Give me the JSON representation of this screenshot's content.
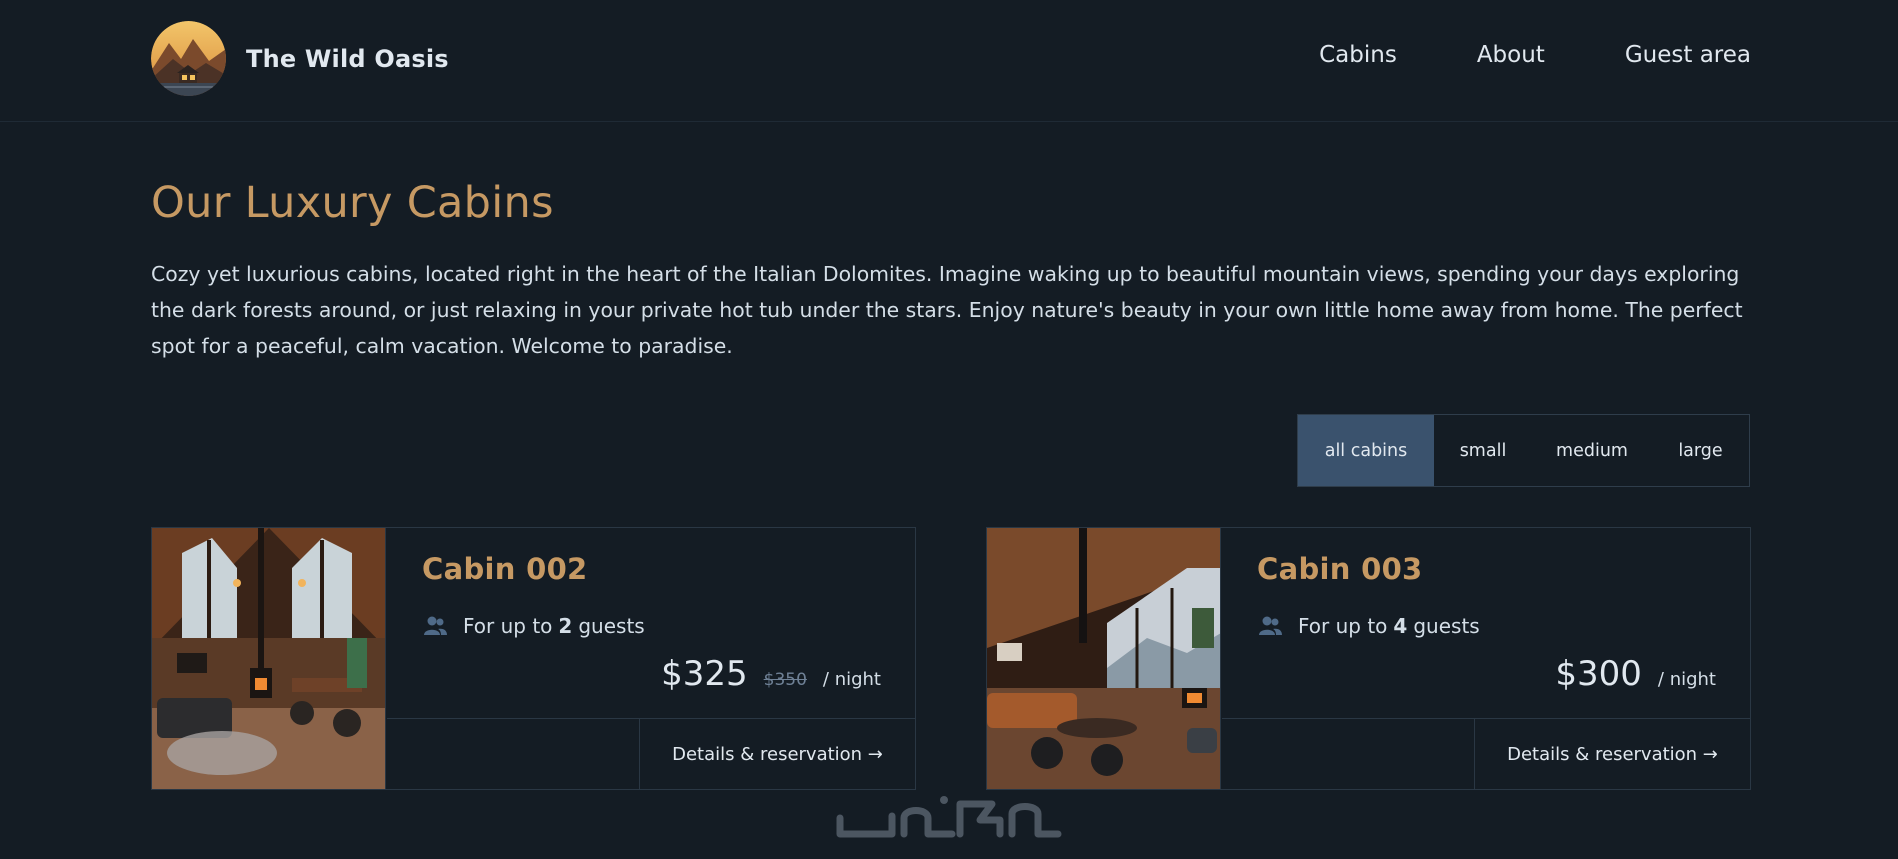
{
  "brand": {
    "name": "The Wild Oasis",
    "logo_icon": "mountain-cabin-logo"
  },
  "nav": [
    {
      "label": "Cabins"
    },
    {
      "label": "About"
    },
    {
      "label": "Guest area"
    }
  ],
  "page": {
    "title": "Our Luxury Cabins",
    "intro": "Cozy yet luxurious cabins, located right in the heart of the Italian Dolomites. Imagine waking up to beautiful mountain views, spending your days exploring the dark forests around, or just relaxing in your private hot tub under the stars. Enjoy nature's beauty in your own little home away from home. The perfect spot for a peaceful, calm vacation. Welcome to paradise."
  },
  "filter": {
    "options": [
      "all cabins",
      "small",
      "medium",
      "large"
    ],
    "active": "all cabins"
  },
  "cabins": [
    {
      "name": "Cabin 002",
      "guests_prefix": "For up to",
      "guests_count": "2",
      "guests_suffix": "guests",
      "price": "$325",
      "old_price": "$350",
      "per_night": "/ night",
      "details_label": "Details & reservation →"
    },
    {
      "name": "Cabin 003",
      "guests_prefix": "For up to",
      "guests_count": "4",
      "guests_suffix": "guests",
      "price": "$300",
      "per_night": "/ night",
      "details_label": "Details & reservation →"
    }
  ],
  "colors": {
    "background": "#141c24",
    "accent": "#c69963",
    "active_filter": "#3a526d",
    "border": "#2a3744"
  }
}
